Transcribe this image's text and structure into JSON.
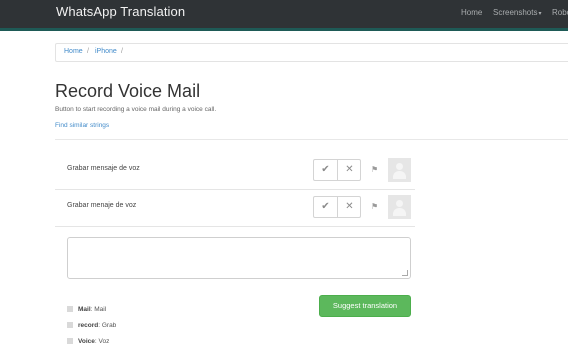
{
  "navbar": {
    "brand": "WhatsApp Translation",
    "links": [
      "Home",
      "Screenshots",
      "Robo"
    ],
    "caret": "▾"
  },
  "breadcrumb": {
    "items": [
      "Home",
      "iPhone"
    ],
    "separator": "/"
  },
  "page": {
    "title": "Record Voice Mail",
    "description": "Button to start recording a voice mail during a voice call.",
    "similar_link": "Find similar strings"
  },
  "translations": [
    {
      "text": "Grabar mensaje de voz"
    },
    {
      "text": "Grabar menaje de voz"
    }
  ],
  "actions": {
    "approve_icon": "check-icon",
    "reject_icon": "close-icon",
    "flag_icon": "flag-icon",
    "check_glyph": "✔",
    "x_glyph": "✕",
    "flag_glyph": "⚑"
  },
  "suggest": {
    "placeholder": "",
    "button_label": "Suggest translation"
  },
  "glossary": [
    {
      "term": "Mail",
      "translation": ": Mail"
    },
    {
      "term": "record",
      "translation": ": Grab"
    },
    {
      "term": "Voice",
      "translation": ": Voz"
    }
  ],
  "colors": {
    "navbar": "#2f3336",
    "accent": "#1e5a56",
    "link": "#428bca",
    "success": "#5cb85c"
  }
}
